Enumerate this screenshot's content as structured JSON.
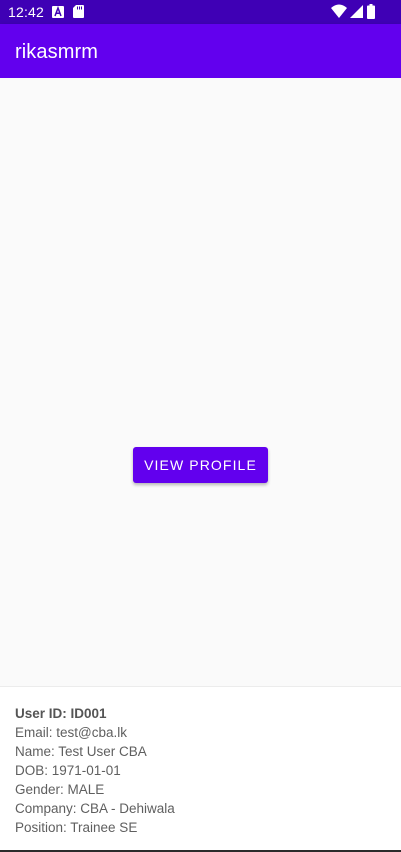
{
  "status_bar": {
    "time": "12:42",
    "icons": [
      "a-notification-icon",
      "sd-card-icon",
      "wifi-icon",
      "cell-signal-icon",
      "battery-icon"
    ]
  },
  "app_bar": {
    "title": "rikasmrm",
    "background": "#6200ee"
  },
  "main": {
    "view_profile_label": "View Profile"
  },
  "profile": {
    "user_id": "User ID: ID001",
    "email": "Email: test@cba.lk",
    "name": "Name: Test User CBA",
    "dob": "DOB: 1971-01-01",
    "gender": "Gender: MALE",
    "company": "Company: CBA - Dehiwala",
    "position": "Position: Trainee SE"
  },
  "colors": {
    "status_bar": "#3f00b5",
    "primary": "#6200ee",
    "text_secondary": "#5f5f5f"
  }
}
